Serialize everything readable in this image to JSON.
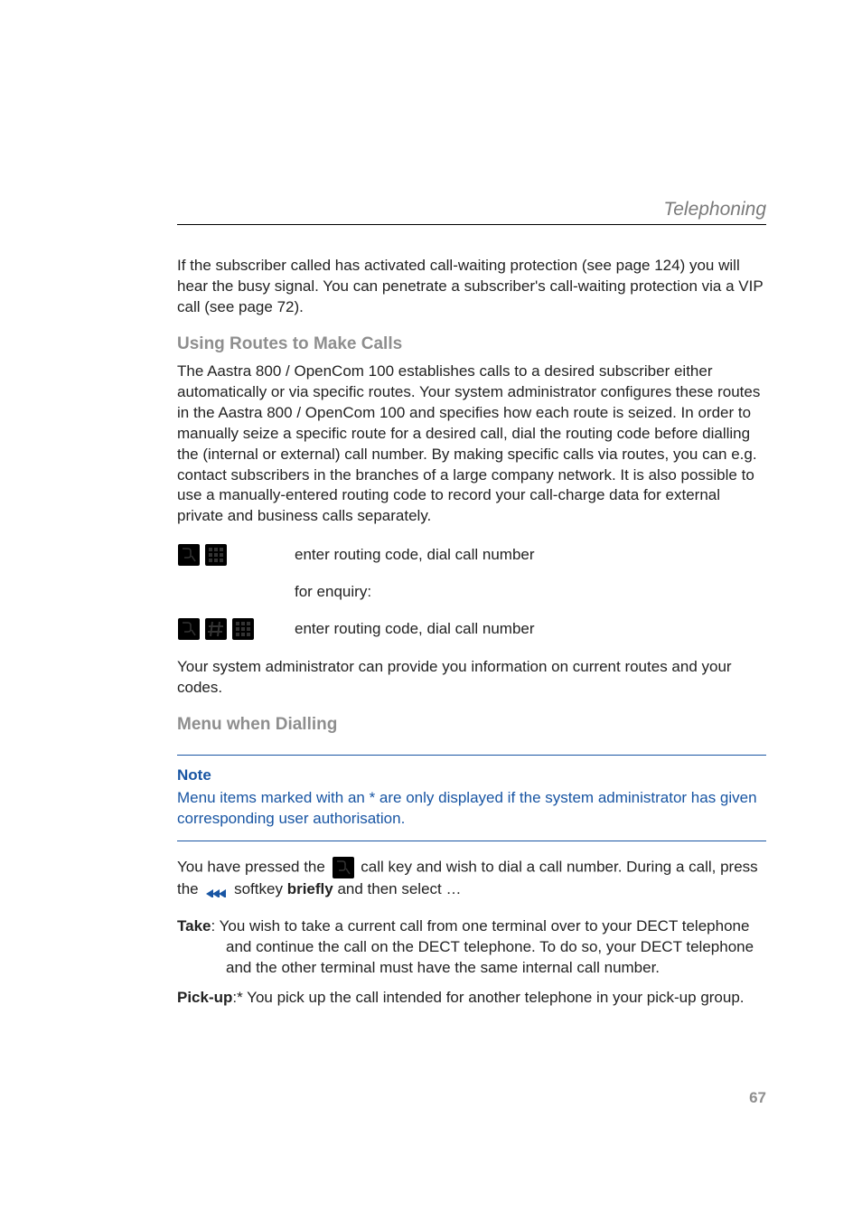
{
  "section_title": "Telephoning",
  "intro": "If the subscriber called has activated call-waiting protection (see page 124) you will hear the busy signal. You can penetrate a subscriber's call-waiting protection via a VIP call (see page 72).",
  "heading_routes": "Using Routes to Make Calls",
  "routes_para": "The Aastra 800 / OpenCom 100 establishes calls to a desired subscriber either automatically or via specific routes. Your system administrator configures these routes in the Aastra 800 / OpenCom 100 and specifies how each route is seized. In order to manually seize a specific route for a desired call, dial the routing code before dialling the (internal or external) call number. By making specific calls via routes, you can e.g. contact subscribers in the branches of a large company network. It is also possible to use a manually-entered routing code to record your call-charge data for external private and business calls separately.",
  "step1_text": "enter routing code, dial call number",
  "step_enquiry": "for enquiry:",
  "step2_text": "enter routing code, dial call number",
  "routes_outro": "Your system administrator can provide you information on current routes and your codes.",
  "heading_menu": "Menu when Dialling",
  "note_label": "Note",
  "note_text": "Menu items marked with an * are only displayed if the system administrator has given corresponding user authorisation.",
  "pressed_pre": "You have pressed the ",
  "pressed_post": " call key and wish to dial a call number. During a call, press the ",
  "pressed_softkey": " softkey ",
  "pressed_briefly": "briefly",
  "pressed_tail": " and then select …",
  "take_term": "Take",
  "take_text_line1": ": You wish to take a current call from one terminal over to your DECT telephone",
  "take_text_line2": "and continue the call on the DECT telephone. To do so, your DECT telephone and the other terminal must have the same internal call number.",
  "pickup_term": "Pick-up",
  "pickup_text": ":* You pick up the call intended for another telephone in your pick-up group.",
  "page_number": "67"
}
